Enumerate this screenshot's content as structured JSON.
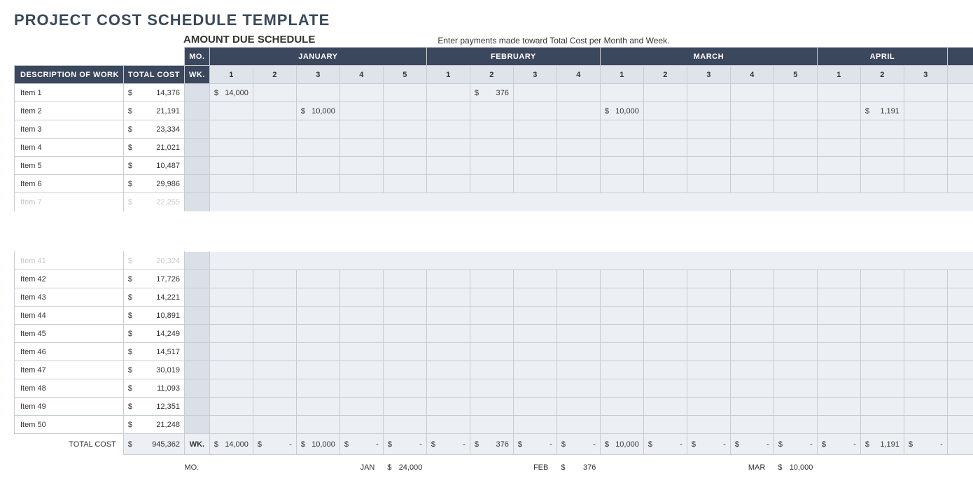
{
  "title": "PROJECT COST SCHEDULE TEMPLATE",
  "amount_due_label": "AMOUNT DUE SCHEDULE",
  "instructions": "Enter payments made toward Total Cost per Month and Week.",
  "headers": {
    "desc": "DESCRIPTION OF WORK",
    "total": "TOTAL COST",
    "mo": "MO.",
    "wk": "WK.",
    "months": [
      {
        "name": "JANUARY",
        "weeks": [
          "1",
          "2",
          "3",
          "4",
          "5"
        ]
      },
      {
        "name": "FEBRUARY",
        "weeks": [
          "1",
          "2",
          "3",
          "4"
        ]
      },
      {
        "name": "MARCH",
        "weeks": [
          "1",
          "2",
          "3",
          "4",
          "5"
        ]
      },
      {
        "name": "APRIL",
        "weeks": [
          "1",
          "2",
          "3"
        ]
      }
    ]
  },
  "top_rows": [
    {
      "name": "Item 1",
      "total": "14,376",
      "payments": {
        "0": "14,000",
        "6": "376"
      }
    },
    {
      "name": "Item 2",
      "total": "21,191",
      "payments": {
        "2": "10,000",
        "9": "10,000",
        "15": "1,191"
      }
    },
    {
      "name": "Item 3",
      "total": "23,334",
      "payments": {}
    },
    {
      "name": "Item 4",
      "total": "21,021",
      "payments": {}
    },
    {
      "name": "Item 5",
      "total": "10,487",
      "payments": {}
    },
    {
      "name": "Item 6",
      "total": "29,986",
      "payments": {}
    }
  ],
  "fade_row_top": {
    "name": "Item 7",
    "total": "22,255"
  },
  "fade_row_bottom": {
    "name": "Item 41",
    "total": "20,324"
  },
  "bottom_rows": [
    {
      "name": "Item 42",
      "total": "17,726",
      "payments": {}
    },
    {
      "name": "Item 43",
      "total": "14,221",
      "payments": {}
    },
    {
      "name": "Item 44",
      "total": "10,891",
      "payments": {}
    },
    {
      "name": "Item 45",
      "total": "14,249",
      "payments": {}
    },
    {
      "name": "Item 46",
      "total": "14,517",
      "payments": {}
    },
    {
      "name": "Item 47",
      "total": "30,019",
      "payments": {}
    },
    {
      "name": "Item 48",
      "total": "11,093",
      "payments": {}
    },
    {
      "name": "Item 49",
      "total": "12,351",
      "payments": {}
    },
    {
      "name": "Item 50",
      "total": "21,248",
      "payments": {}
    }
  ],
  "totals": {
    "label": "TOTAL COST",
    "grand": "945,362",
    "wk": "WK.",
    "weekly": [
      "14,000",
      "-",
      "10,000",
      "-",
      "-",
      "-",
      "376",
      "-",
      "-",
      "10,000",
      "-",
      "-",
      "-",
      "-",
      "-",
      "1,191",
      "-",
      ""
    ]
  },
  "monthly": {
    "label": "MO.",
    "entries": [
      {
        "col": 4,
        "abbr": "JAN",
        "amount": "24,000"
      },
      {
        "col": 8,
        "abbr": "FEB",
        "amount": "376"
      },
      {
        "col": 13,
        "abbr": "MAR",
        "amount": "10,000"
      }
    ]
  }
}
